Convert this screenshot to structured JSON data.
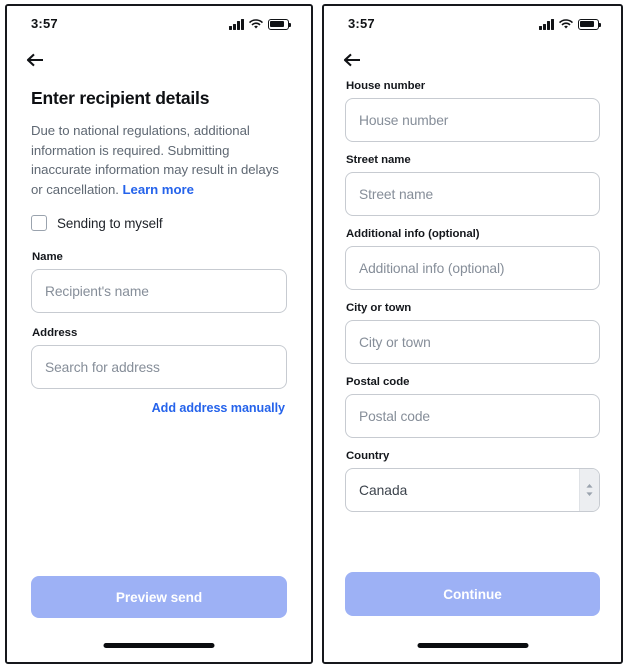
{
  "theme": {
    "link_blue": "#2563eb",
    "cta_blue": "#9db1f5",
    "text_dark": "#0e1013",
    "text_muted": "#5f6873",
    "placeholder": "#868e99",
    "border": "#c7cbd1"
  },
  "left_phone": {
    "status_bar": {
      "time": "3:57",
      "cellular_icon": "cellular-bars-icon",
      "wifi_icon": "wifi-icon",
      "battery_icon": "battery-icon"
    },
    "back_icon": "back-arrow-icon",
    "title": "Enter recipient details",
    "description": "Due to national regulations, additional information is required. Submitting inaccurate information may result in delays or cancellation.",
    "learn_more_label": "Learn more",
    "checkbox": {
      "label": "Sending to myself",
      "checked": false
    },
    "fields": [
      {
        "label": "Name",
        "placeholder": "Recipient's name",
        "value": ""
      },
      {
        "label": "Address",
        "placeholder": "Search for address",
        "value": ""
      }
    ],
    "manual_link_label": "Add address manually",
    "cta_label": "Preview send"
  },
  "right_phone": {
    "status_bar": {
      "time": "3:57",
      "cellular_icon": "cellular-bars-icon",
      "wifi_icon": "wifi-icon",
      "battery_icon": "battery-icon"
    },
    "back_icon": "back-arrow-icon",
    "fields": [
      {
        "label": "House number",
        "placeholder": "House number",
        "value": ""
      },
      {
        "label": "Street name",
        "placeholder": "Street name",
        "value": ""
      },
      {
        "label": "Additional info (optional)",
        "placeholder": "Additional info (optional)",
        "value": ""
      },
      {
        "label": "City or town",
        "placeholder": "City or town",
        "value": ""
      },
      {
        "label": "Postal code",
        "placeholder": "Postal code",
        "value": ""
      }
    ],
    "country": {
      "label": "Country",
      "selected": "Canada",
      "chevron_icon": "chevron-up-down-icon"
    },
    "cta_label": "Continue"
  }
}
